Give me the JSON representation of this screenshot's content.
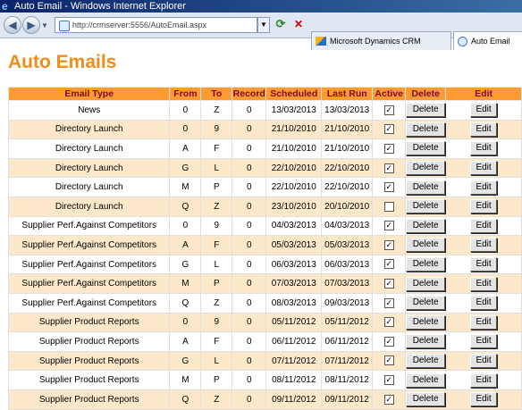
{
  "window": {
    "title": "Auto Email - Windows Internet Explorer"
  },
  "browser": {
    "back_icon": "back-arrow-icon",
    "forward_icon": "forward-arrow-icon",
    "address": "http://crmserver:5556/AutoEmail.aspx",
    "tabs": [
      {
        "label": "Microsoft Dynamics CRM",
        "icon": "crm-logo-icon"
      },
      {
        "label": "Auto Email",
        "icon": "ie-page-icon"
      }
    ]
  },
  "page": {
    "title": "Auto Emails"
  },
  "table": {
    "headers": [
      "Email Type",
      "From",
      "To",
      "Record",
      "Scheduled",
      "Last Run",
      "Active",
      "Delete",
      "Edit"
    ],
    "delete_label": "Delete",
    "edit_label": "Edit",
    "check_mark": "✓",
    "rows": [
      {
        "type": "News",
        "from": "0",
        "to": "Z",
        "record": "0",
        "scheduled": "13/03/2013",
        "last_run": "13/03/2013",
        "active": true
      },
      {
        "type": "Directory Launch",
        "from": "0",
        "to": "9",
        "record": "0",
        "scheduled": "21/10/2010",
        "last_run": "21/10/2010",
        "active": true
      },
      {
        "type": "Directory Launch",
        "from": "A",
        "to": "F",
        "record": "0",
        "scheduled": "21/10/2010",
        "last_run": "21/10/2010",
        "active": true
      },
      {
        "type": "Directory Launch",
        "from": "G",
        "to": "L",
        "record": "0",
        "scheduled": "22/10/2010",
        "last_run": "22/10/2010",
        "active": true
      },
      {
        "type": "Directory Launch",
        "from": "M",
        "to": "P",
        "record": "0",
        "scheduled": "22/10/2010",
        "last_run": "22/10/2010",
        "active": true
      },
      {
        "type": "Directory Launch",
        "from": "Q",
        "to": "Z",
        "record": "0",
        "scheduled": "23/10/2010",
        "last_run": "20/10/2010",
        "active": false
      },
      {
        "type": "Supplier Perf.Against Competitors",
        "from": "0",
        "to": "9",
        "record": "0",
        "scheduled": "04/03/2013",
        "last_run": "04/03/2013",
        "active": true
      },
      {
        "type": "Supplier Perf.Against Competitors",
        "from": "A",
        "to": "F",
        "record": "0",
        "scheduled": "05/03/2013",
        "last_run": "05/03/2013",
        "active": true
      },
      {
        "type": "Supplier Perf.Against Competitors",
        "from": "G",
        "to": "L",
        "record": "0",
        "scheduled": "06/03/2013",
        "last_run": "06/03/2013",
        "active": true
      },
      {
        "type": "Supplier Perf.Against Competitors",
        "from": "M",
        "to": "P",
        "record": "0",
        "scheduled": "07/03/2013",
        "last_run": "07/03/2013",
        "active": true
      },
      {
        "type": "Supplier Perf.Against Competitors",
        "from": "Q",
        "to": "Z",
        "record": "0",
        "scheduled": "08/03/2013",
        "last_run": "09/03/2013",
        "active": true
      },
      {
        "type": "Supplier Product Reports",
        "from": "0",
        "to": "9",
        "record": "0",
        "scheduled": "05/11/2012",
        "last_run": "05/11/2012",
        "active": true
      },
      {
        "type": "Supplier Product Reports",
        "from": "A",
        "to": "F",
        "record": "0",
        "scheduled": "06/11/2012",
        "last_run": "06/11/2012",
        "active": true
      },
      {
        "type": "Supplier Product Reports",
        "from": "G",
        "to": "L",
        "record": "0",
        "scheduled": "07/11/2012",
        "last_run": "07/11/2012",
        "active": true
      },
      {
        "type": "Supplier Product Reports",
        "from": "M",
        "to": "P",
        "record": "0",
        "scheduled": "08/11/2012",
        "last_run": "08/11/2012",
        "active": true
      },
      {
        "type": "Supplier Product Reports",
        "from": "Q",
        "to": "Z",
        "record": "0",
        "scheduled": "09/11/2012",
        "last_run": "09/11/2012",
        "active": true
      }
    ]
  },
  "colors": {
    "title": "#f28c18",
    "header_bg": "#ff9a33",
    "header_text": "#7a0a2a",
    "alt_row": "#fde9c9"
  }
}
